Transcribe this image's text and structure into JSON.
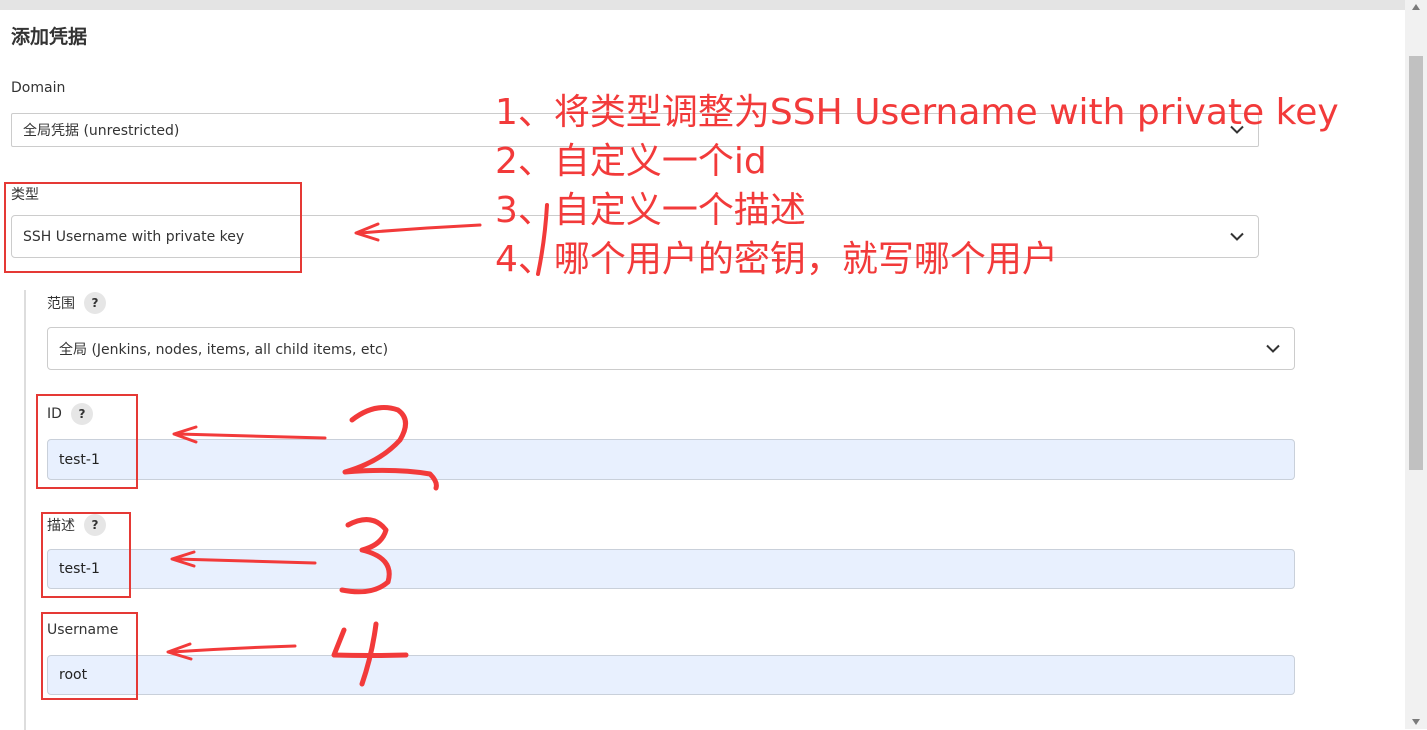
{
  "page": {
    "title": "添加凭据"
  },
  "domain": {
    "label": "Domain",
    "value": "全局凭据 (unrestricted)"
  },
  "kind": {
    "label": "类型",
    "value": "SSH Username with private key"
  },
  "scope": {
    "label": "范围",
    "help": "?",
    "value": "全局 (Jenkins, nodes, items, all child items, etc)"
  },
  "id_field": {
    "label": "ID",
    "help": "?",
    "value": "test-1"
  },
  "description": {
    "label": "描述",
    "help": "?",
    "value": "test-1"
  },
  "username": {
    "label": "Username",
    "value": "root"
  },
  "annotations": {
    "notes": [
      "1、将类型调整为SSH Username with private key",
      "2、自定义一个id",
      "3、自定义一个描述",
      "4、哪个用户的密钥，就写哪个用户"
    ],
    "numbers": [
      "1",
      "2",
      "3",
      "4"
    ],
    "color": "#f23a3a"
  }
}
